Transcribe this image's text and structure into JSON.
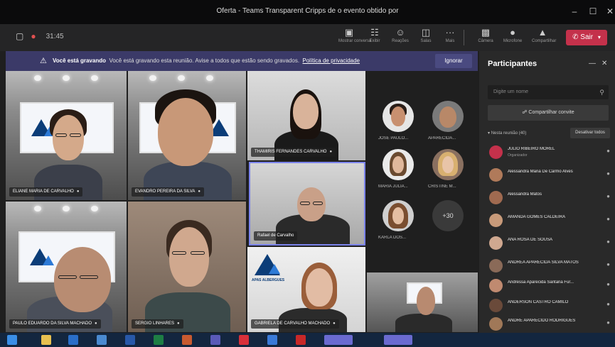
{
  "window": {
    "title": "Oferta - Teams Transparent Cripps de o evento obtido por",
    "minimize_glyph": "–",
    "maximize_glyph": "☐",
    "close_glyph": "✕"
  },
  "toolbar": {
    "timer": "31:45",
    "buttons": [
      {
        "icon": "chat-icon",
        "label": "Mostrar conversa"
      },
      {
        "icon": "share-icon",
        "label": "Exibir"
      },
      {
        "icon": "people-icon",
        "label": "Reações"
      },
      {
        "icon": "rooms-icon",
        "label": "Salas"
      },
      {
        "icon": "more-icon",
        "label": "Mais"
      },
      {
        "icon": "camera-icon",
        "label": "Câmera"
      },
      {
        "icon": "mic-icon",
        "label": "Microfone"
      },
      {
        "icon": "screen-share-icon",
        "label": "Compartilhar"
      }
    ],
    "leave_label": "Sair"
  },
  "banner": {
    "title": "Você está gravando",
    "message": "Você está gravando esta reunião. Avise a todos que estão sendo gravados.",
    "link": "Política de privacidade",
    "dismiss_label": "Ignorar"
  },
  "video_tiles": [
    {
      "name": "ELIANE MARIA DE CARVALHO"
    },
    {
      "name": "EVANDRO PEREIRA DA SILVA"
    },
    {
      "name": "THAMIRIS FERNANDES CARVALHO"
    },
    {
      "name": "Rafael de Carvalho"
    },
    {
      "name": "PAULO EDUARDO DA SILVA MACHADO"
    },
    {
      "name": "SERGIO LINHARES"
    },
    {
      "name": "GABRIELA DE CARVALHO MACHADO"
    }
  ],
  "screen_logo_text": "APAS ALBERGUES",
  "avatar_grid": [
    {
      "name": "JOSÉ PAULO..."
    },
    {
      "name": "APARECIDA..."
    },
    {
      "name": "MARIA JULIA..."
    },
    {
      "name": "CRISTINE M..."
    },
    {
      "name": "KARLA DOS..."
    }
  ],
  "more_count": "+30",
  "panel": {
    "title": "Participantes",
    "search_placeholder": "Digite um nome",
    "share_label": "Compartilhar convite",
    "section_label": "Nesta reunião (40)",
    "mute_all_label": "Desativar todos",
    "participants": [
      {
        "name": "JULIO RIBEIRO MOREL",
        "sub": "Organizador",
        "color": "#c4314b"
      },
      {
        "name": "Alessandra Maria De Carmo Alves",
        "sub": "",
        "color": "#b07a5a"
      },
      {
        "name": "Alessandra Matos",
        "sub": "",
        "color": "#a06a50"
      },
      {
        "name": "AMANDA GOMES CALDEIRA",
        "sub": "",
        "color": "#c89a7a"
      },
      {
        "name": "ANA ROSA DE SOUSA",
        "sub": "",
        "color": "#d0a890"
      },
      {
        "name": "ANDREA APARECIDA SILVA MATOS",
        "sub": "",
        "color": "#8a6a58"
      },
      {
        "name": "Andressa Aparecida Santana Fur...",
        "sub": "",
        "color": "#c08a70"
      },
      {
        "name": "ANDERSON CASTRO CAMILO",
        "sub": "",
        "color": "#6a4a3a"
      },
      {
        "name": "ANDRÉ APARECIDO RODRIGUES",
        "sub": "",
        "color": "#a07858"
      }
    ]
  }
}
